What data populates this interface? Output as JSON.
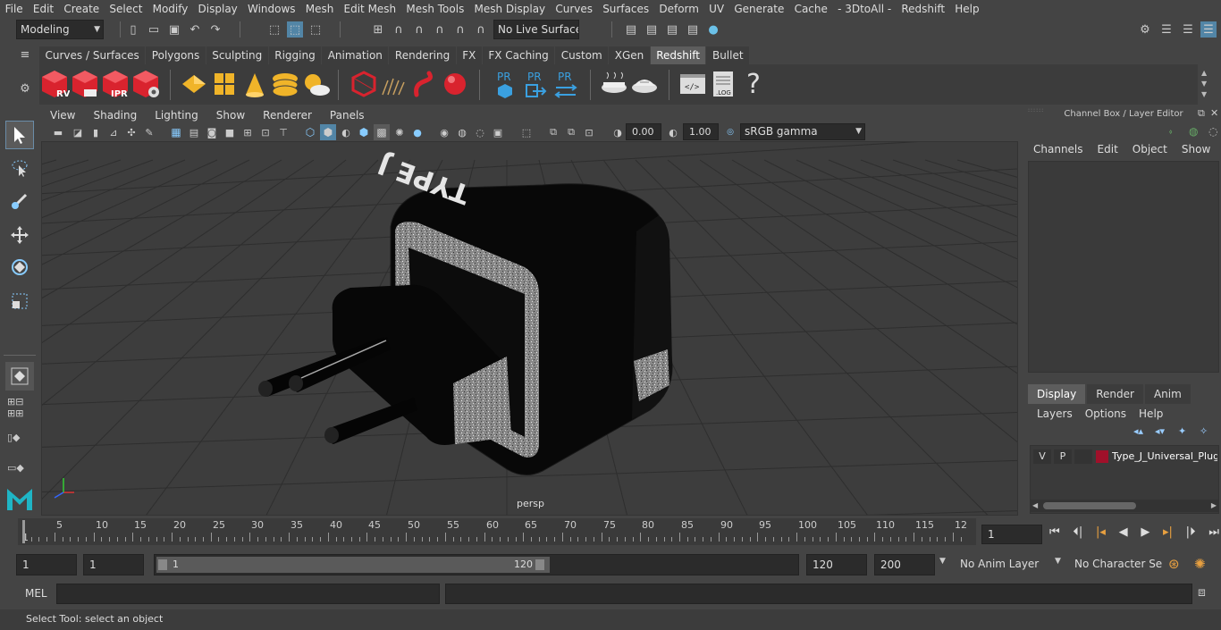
{
  "menubar": [
    "File",
    "Edit",
    "Create",
    "Select",
    "Modify",
    "Display",
    "Windows",
    "Mesh",
    "Edit Mesh",
    "Mesh Tools",
    "Mesh Display",
    "Curves",
    "Surfaces",
    "Deform",
    "UV",
    "Generate",
    "Cache",
    "- 3DtoAll -",
    "Redshift",
    "Help"
  ],
  "status": {
    "mode": "Modeling",
    "live_surface": "No Live Surface"
  },
  "shelf_tabs": [
    "Curves / Surfaces",
    "Polygons",
    "Sculpting",
    "Rigging",
    "Animation",
    "Rendering",
    "FX",
    "FX Caching",
    "Custom",
    "XGen",
    "Redshift",
    "Bullet"
  ],
  "shelf_active": "Redshift",
  "shelf_labels": {
    "rv": "RV",
    "ipr": "IPR",
    "pr1": "PR",
    "pr2": "PR",
    "pr3": "PR",
    "log": ".LOG",
    "help": "?"
  },
  "viewport": {
    "menu": [
      "View",
      "Shading",
      "Lighting",
      "Show",
      "Renderer",
      "Panels"
    ],
    "exposure": "0.00",
    "gamma": "1.00",
    "colorspace": "sRGB gamma",
    "camera_label": "persp",
    "plug_text": "TYPE J"
  },
  "channelbox": {
    "title": "Channel Box / Layer Editor",
    "menu": [
      "Channels",
      "Edit",
      "Object",
      "Show"
    ]
  },
  "layers": {
    "tabs": [
      "Display",
      "Render",
      "Anim"
    ],
    "active_tab": "Display",
    "menu": [
      "Layers",
      "Options",
      "Help"
    ],
    "rows": [
      {
        "v": "V",
        "p": "P",
        "name": "Type_J_Universal_Plug",
        "color": "#a0102a"
      }
    ]
  },
  "timeline": {
    "labels": [
      "5",
      "10",
      "15",
      "20",
      "25",
      "30",
      "35",
      "40",
      "45",
      "50",
      "55",
      "60",
      "65",
      "70",
      "75",
      "80",
      "85",
      "90",
      "95",
      "100",
      "105",
      "110",
      "115",
      "12"
    ],
    "start_label": "1",
    "current_frame": "1"
  },
  "range": {
    "start": "1",
    "playback_start": "1",
    "slider_start": "1",
    "slider_end": "120",
    "playback_end": "120",
    "end": "200",
    "anim_layer": "No Anim Layer",
    "char_set": "No Character Set"
  },
  "mel": {
    "label": "MEL"
  },
  "help": {
    "text": "Select Tool: select an object"
  },
  "colors": {
    "accent": "#5285a6",
    "redshift_red": "#d9232e",
    "shelf_yellow": "#f0b429"
  }
}
